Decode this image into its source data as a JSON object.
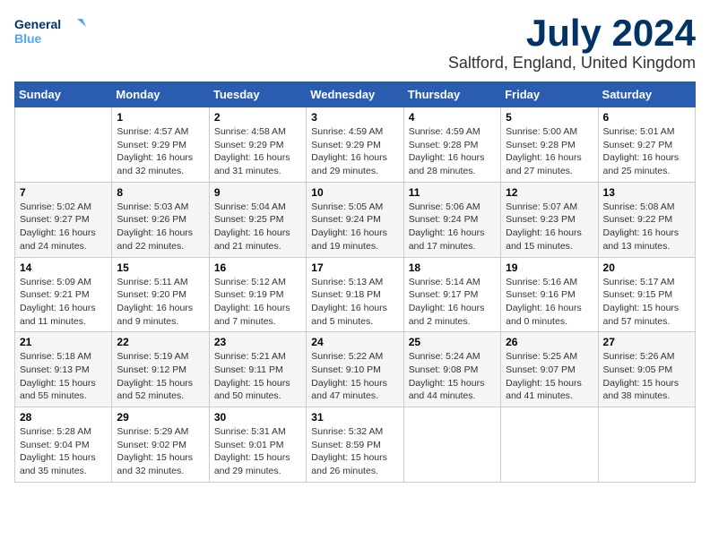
{
  "header": {
    "logo_line1": "General",
    "logo_line2": "Blue",
    "month": "July 2024",
    "location": "Saltford, England, United Kingdom"
  },
  "days_of_week": [
    "Sunday",
    "Monday",
    "Tuesday",
    "Wednesday",
    "Thursday",
    "Friday",
    "Saturday"
  ],
  "weeks": [
    [
      {
        "day": "",
        "info": ""
      },
      {
        "day": "1",
        "info": "Sunrise: 4:57 AM\nSunset: 9:29 PM\nDaylight: 16 hours\nand 32 minutes."
      },
      {
        "day": "2",
        "info": "Sunrise: 4:58 AM\nSunset: 9:29 PM\nDaylight: 16 hours\nand 31 minutes."
      },
      {
        "day": "3",
        "info": "Sunrise: 4:59 AM\nSunset: 9:29 PM\nDaylight: 16 hours\nand 29 minutes."
      },
      {
        "day": "4",
        "info": "Sunrise: 4:59 AM\nSunset: 9:28 PM\nDaylight: 16 hours\nand 28 minutes."
      },
      {
        "day": "5",
        "info": "Sunrise: 5:00 AM\nSunset: 9:28 PM\nDaylight: 16 hours\nand 27 minutes."
      },
      {
        "day": "6",
        "info": "Sunrise: 5:01 AM\nSunset: 9:27 PM\nDaylight: 16 hours\nand 25 minutes."
      }
    ],
    [
      {
        "day": "7",
        "info": "Sunrise: 5:02 AM\nSunset: 9:27 PM\nDaylight: 16 hours\nand 24 minutes."
      },
      {
        "day": "8",
        "info": "Sunrise: 5:03 AM\nSunset: 9:26 PM\nDaylight: 16 hours\nand 22 minutes."
      },
      {
        "day": "9",
        "info": "Sunrise: 5:04 AM\nSunset: 9:25 PM\nDaylight: 16 hours\nand 21 minutes."
      },
      {
        "day": "10",
        "info": "Sunrise: 5:05 AM\nSunset: 9:24 PM\nDaylight: 16 hours\nand 19 minutes."
      },
      {
        "day": "11",
        "info": "Sunrise: 5:06 AM\nSunset: 9:24 PM\nDaylight: 16 hours\nand 17 minutes."
      },
      {
        "day": "12",
        "info": "Sunrise: 5:07 AM\nSunset: 9:23 PM\nDaylight: 16 hours\nand 15 minutes."
      },
      {
        "day": "13",
        "info": "Sunrise: 5:08 AM\nSunset: 9:22 PM\nDaylight: 16 hours\nand 13 minutes."
      }
    ],
    [
      {
        "day": "14",
        "info": "Sunrise: 5:09 AM\nSunset: 9:21 PM\nDaylight: 16 hours\nand 11 minutes."
      },
      {
        "day": "15",
        "info": "Sunrise: 5:11 AM\nSunset: 9:20 PM\nDaylight: 16 hours\nand 9 minutes."
      },
      {
        "day": "16",
        "info": "Sunrise: 5:12 AM\nSunset: 9:19 PM\nDaylight: 16 hours\nand 7 minutes."
      },
      {
        "day": "17",
        "info": "Sunrise: 5:13 AM\nSunset: 9:18 PM\nDaylight: 16 hours\nand 5 minutes."
      },
      {
        "day": "18",
        "info": "Sunrise: 5:14 AM\nSunset: 9:17 PM\nDaylight: 16 hours\nand 2 minutes."
      },
      {
        "day": "19",
        "info": "Sunrise: 5:16 AM\nSunset: 9:16 PM\nDaylight: 16 hours\nand 0 minutes."
      },
      {
        "day": "20",
        "info": "Sunrise: 5:17 AM\nSunset: 9:15 PM\nDaylight: 15 hours\nand 57 minutes."
      }
    ],
    [
      {
        "day": "21",
        "info": "Sunrise: 5:18 AM\nSunset: 9:13 PM\nDaylight: 15 hours\nand 55 minutes."
      },
      {
        "day": "22",
        "info": "Sunrise: 5:19 AM\nSunset: 9:12 PM\nDaylight: 15 hours\nand 52 minutes."
      },
      {
        "day": "23",
        "info": "Sunrise: 5:21 AM\nSunset: 9:11 PM\nDaylight: 15 hours\nand 50 minutes."
      },
      {
        "day": "24",
        "info": "Sunrise: 5:22 AM\nSunset: 9:10 PM\nDaylight: 15 hours\nand 47 minutes."
      },
      {
        "day": "25",
        "info": "Sunrise: 5:24 AM\nSunset: 9:08 PM\nDaylight: 15 hours\nand 44 minutes."
      },
      {
        "day": "26",
        "info": "Sunrise: 5:25 AM\nSunset: 9:07 PM\nDaylight: 15 hours\nand 41 minutes."
      },
      {
        "day": "27",
        "info": "Sunrise: 5:26 AM\nSunset: 9:05 PM\nDaylight: 15 hours\nand 38 minutes."
      }
    ],
    [
      {
        "day": "28",
        "info": "Sunrise: 5:28 AM\nSunset: 9:04 PM\nDaylight: 15 hours\nand 35 minutes."
      },
      {
        "day": "29",
        "info": "Sunrise: 5:29 AM\nSunset: 9:02 PM\nDaylight: 15 hours\nand 32 minutes."
      },
      {
        "day": "30",
        "info": "Sunrise: 5:31 AM\nSunset: 9:01 PM\nDaylight: 15 hours\nand 29 minutes."
      },
      {
        "day": "31",
        "info": "Sunrise: 5:32 AM\nSunset: 8:59 PM\nDaylight: 15 hours\nand 26 minutes."
      },
      {
        "day": "",
        "info": ""
      },
      {
        "day": "",
        "info": ""
      },
      {
        "day": "",
        "info": ""
      }
    ]
  ]
}
